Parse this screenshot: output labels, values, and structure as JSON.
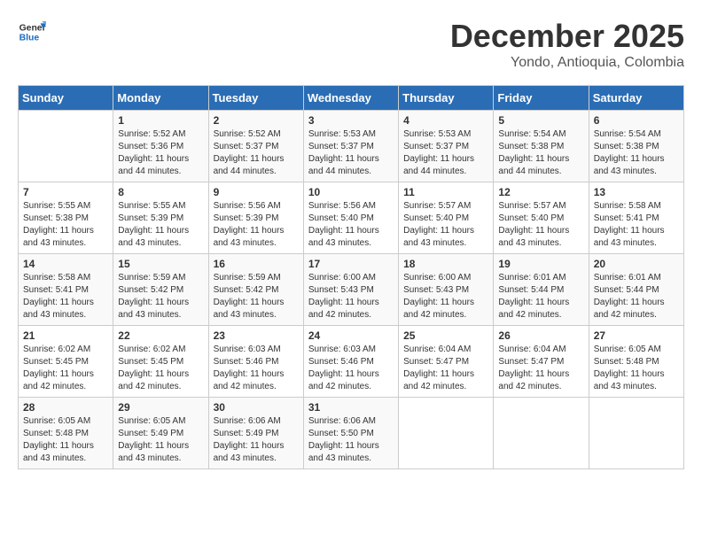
{
  "header": {
    "logo_line1": "General",
    "logo_line2": "Blue",
    "month": "December 2025",
    "location": "Yondo, Antioquia, Colombia"
  },
  "days_of_week": [
    "Sunday",
    "Monday",
    "Tuesday",
    "Wednesday",
    "Thursday",
    "Friday",
    "Saturday"
  ],
  "weeks": [
    [
      {
        "day": "",
        "content": ""
      },
      {
        "day": "1",
        "content": "Sunrise: 5:52 AM\nSunset: 5:36 PM\nDaylight: 11 hours\nand 44 minutes."
      },
      {
        "day": "2",
        "content": "Sunrise: 5:52 AM\nSunset: 5:37 PM\nDaylight: 11 hours\nand 44 minutes."
      },
      {
        "day": "3",
        "content": "Sunrise: 5:53 AM\nSunset: 5:37 PM\nDaylight: 11 hours\nand 44 minutes."
      },
      {
        "day": "4",
        "content": "Sunrise: 5:53 AM\nSunset: 5:37 PM\nDaylight: 11 hours\nand 44 minutes."
      },
      {
        "day": "5",
        "content": "Sunrise: 5:54 AM\nSunset: 5:38 PM\nDaylight: 11 hours\nand 44 minutes."
      },
      {
        "day": "6",
        "content": "Sunrise: 5:54 AM\nSunset: 5:38 PM\nDaylight: 11 hours\nand 43 minutes."
      }
    ],
    [
      {
        "day": "7",
        "content": "Sunrise: 5:55 AM\nSunset: 5:38 PM\nDaylight: 11 hours\nand 43 minutes."
      },
      {
        "day": "8",
        "content": "Sunrise: 5:55 AM\nSunset: 5:39 PM\nDaylight: 11 hours\nand 43 minutes."
      },
      {
        "day": "9",
        "content": "Sunrise: 5:56 AM\nSunset: 5:39 PM\nDaylight: 11 hours\nand 43 minutes."
      },
      {
        "day": "10",
        "content": "Sunrise: 5:56 AM\nSunset: 5:40 PM\nDaylight: 11 hours\nand 43 minutes."
      },
      {
        "day": "11",
        "content": "Sunrise: 5:57 AM\nSunset: 5:40 PM\nDaylight: 11 hours\nand 43 minutes."
      },
      {
        "day": "12",
        "content": "Sunrise: 5:57 AM\nSunset: 5:40 PM\nDaylight: 11 hours\nand 43 minutes."
      },
      {
        "day": "13",
        "content": "Sunrise: 5:58 AM\nSunset: 5:41 PM\nDaylight: 11 hours\nand 43 minutes."
      }
    ],
    [
      {
        "day": "14",
        "content": "Sunrise: 5:58 AM\nSunset: 5:41 PM\nDaylight: 11 hours\nand 43 minutes."
      },
      {
        "day": "15",
        "content": "Sunrise: 5:59 AM\nSunset: 5:42 PM\nDaylight: 11 hours\nand 43 minutes."
      },
      {
        "day": "16",
        "content": "Sunrise: 5:59 AM\nSunset: 5:42 PM\nDaylight: 11 hours\nand 43 minutes."
      },
      {
        "day": "17",
        "content": "Sunrise: 6:00 AM\nSunset: 5:43 PM\nDaylight: 11 hours\nand 42 minutes."
      },
      {
        "day": "18",
        "content": "Sunrise: 6:00 AM\nSunset: 5:43 PM\nDaylight: 11 hours\nand 42 minutes."
      },
      {
        "day": "19",
        "content": "Sunrise: 6:01 AM\nSunset: 5:44 PM\nDaylight: 11 hours\nand 42 minutes."
      },
      {
        "day": "20",
        "content": "Sunrise: 6:01 AM\nSunset: 5:44 PM\nDaylight: 11 hours\nand 42 minutes."
      }
    ],
    [
      {
        "day": "21",
        "content": "Sunrise: 6:02 AM\nSunset: 5:45 PM\nDaylight: 11 hours\nand 42 minutes."
      },
      {
        "day": "22",
        "content": "Sunrise: 6:02 AM\nSunset: 5:45 PM\nDaylight: 11 hours\nand 42 minutes."
      },
      {
        "day": "23",
        "content": "Sunrise: 6:03 AM\nSunset: 5:46 PM\nDaylight: 11 hours\nand 42 minutes."
      },
      {
        "day": "24",
        "content": "Sunrise: 6:03 AM\nSunset: 5:46 PM\nDaylight: 11 hours\nand 42 minutes."
      },
      {
        "day": "25",
        "content": "Sunrise: 6:04 AM\nSunset: 5:47 PM\nDaylight: 11 hours\nand 42 minutes."
      },
      {
        "day": "26",
        "content": "Sunrise: 6:04 AM\nSunset: 5:47 PM\nDaylight: 11 hours\nand 42 minutes."
      },
      {
        "day": "27",
        "content": "Sunrise: 6:05 AM\nSunset: 5:48 PM\nDaylight: 11 hours\nand 43 minutes."
      }
    ],
    [
      {
        "day": "28",
        "content": "Sunrise: 6:05 AM\nSunset: 5:48 PM\nDaylight: 11 hours\nand 43 minutes."
      },
      {
        "day": "29",
        "content": "Sunrise: 6:05 AM\nSunset: 5:49 PM\nDaylight: 11 hours\nand 43 minutes."
      },
      {
        "day": "30",
        "content": "Sunrise: 6:06 AM\nSunset: 5:49 PM\nDaylight: 11 hours\nand 43 minutes."
      },
      {
        "day": "31",
        "content": "Sunrise: 6:06 AM\nSunset: 5:50 PM\nDaylight: 11 hours\nand 43 minutes."
      },
      {
        "day": "",
        "content": ""
      },
      {
        "day": "",
        "content": ""
      },
      {
        "day": "",
        "content": ""
      }
    ]
  ]
}
